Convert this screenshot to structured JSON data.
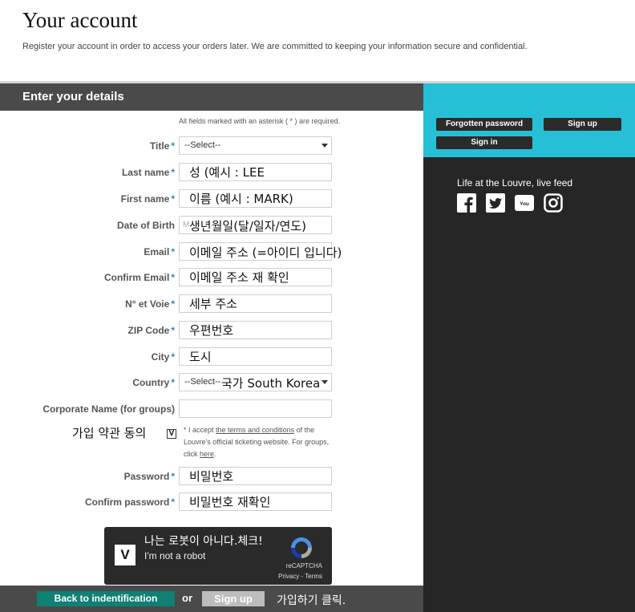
{
  "header": {
    "title": "Your account",
    "intro": "Register your account in order to access your orders later. We are committed to keeping your information secure and confidential."
  },
  "form": {
    "section_title": "Enter your details",
    "required_note": "All fields marked with an asterisk ( * ) are required.",
    "asterisk": "*",
    "fields": {
      "title": {
        "label": "Title",
        "value": "--Select--"
      },
      "last_name": {
        "label": "Last name",
        "value": "성 (예시 : LEE"
      },
      "first_name": {
        "label": "First name",
        "value": "이름 (예시 : MARK)"
      },
      "dob": {
        "label": "Date of Birth",
        "hint": "M",
        "value": "생년월일(달/일자/연도)"
      },
      "email": {
        "label": "Email",
        "value": "이메일 주소 (=아이디 입니다)"
      },
      "confirm_email": {
        "label": "Confirm Email",
        "value": "이메일 주소 재 확인"
      },
      "street": {
        "label": "N° et Voie",
        "value": "세부 주소"
      },
      "zip": {
        "label": "ZIP Code",
        "value": "우편번호"
      },
      "city": {
        "label": "City",
        "value": "도시"
      },
      "country": {
        "label": "Country",
        "value": "--Select--",
        "overlay": "국가 South Korea"
      },
      "corporate": {
        "label": "Corporate Name (for groups)",
        "value": ""
      },
      "password": {
        "label": "Password",
        "value": "비밀번호"
      },
      "confirm_password": {
        "label": "Confirm password",
        "value": "비밀번호 재확인"
      }
    },
    "terms": {
      "annotation": "가입 약관 동의",
      "checkbox_mark": "V",
      "text_prefix": "* I accept ",
      "link_text": "the terms and conditions",
      "text_middle": " of the Louvre's official ticketing website. For groups, click ",
      "here_link": "here",
      "text_suffix": "."
    },
    "captcha": {
      "check_mark": "V",
      "annotation": "나는 로봇이 아니다.체크!",
      "label": "I'm not a robot",
      "brand": "reCAPTCHA",
      "links": "Privacy - Terms"
    },
    "actions": {
      "back_label": "Back to indentification",
      "or_label": "or",
      "signup_label": "Sign up",
      "signup_annotation": "가입하기 클릭."
    }
  },
  "sidebar": {
    "forgotten_password": "Forgotten password",
    "sign_up": "Sign up",
    "sign_in": "Sign in",
    "feed_title": "Life at the Louvre, live feed",
    "social_icons": [
      "facebook-icon",
      "twitter-icon",
      "youtube-icon",
      "instagram-icon"
    ]
  },
  "colors": {
    "accent_cyan": "#27bfd6",
    "header_gray": "#4a4a4a",
    "sidebar_dark": "#262626",
    "back_green": "#0f8072",
    "asterisk_blue": "#2b8bb0"
  }
}
